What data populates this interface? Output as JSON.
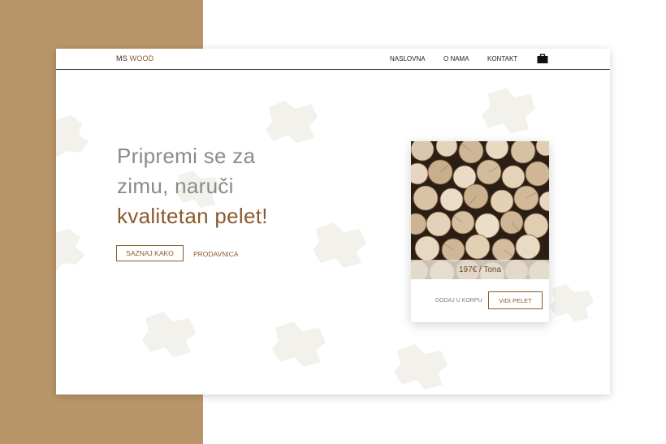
{
  "nav": {
    "logo_prefix": "MS",
    "logo_suffix": "WOOD",
    "links": [
      {
        "label": "NASLOVNA"
      },
      {
        "label": "O NAMA"
      },
      {
        "label": "KONTAKT"
      }
    ],
    "cart_icon": "shopping-bag-icon"
  },
  "hero": {
    "line1": "Pripremi se za",
    "line2": "zimu, naruči",
    "line3": "kvalitetan pelet!",
    "cta_label": "SAZNAJ KAKO",
    "shop_label": "PRODAVNICA"
  },
  "product": {
    "price": "197€ / Tona",
    "add_label": "DODAJ U KORPU",
    "view_label": "VIDI PELET",
    "image": "stacked-firewood-logs"
  },
  "colors": {
    "accent": "#8b5a2b",
    "side_panel": "#b9966a",
    "muted_heading": "#8b8b8b"
  }
}
